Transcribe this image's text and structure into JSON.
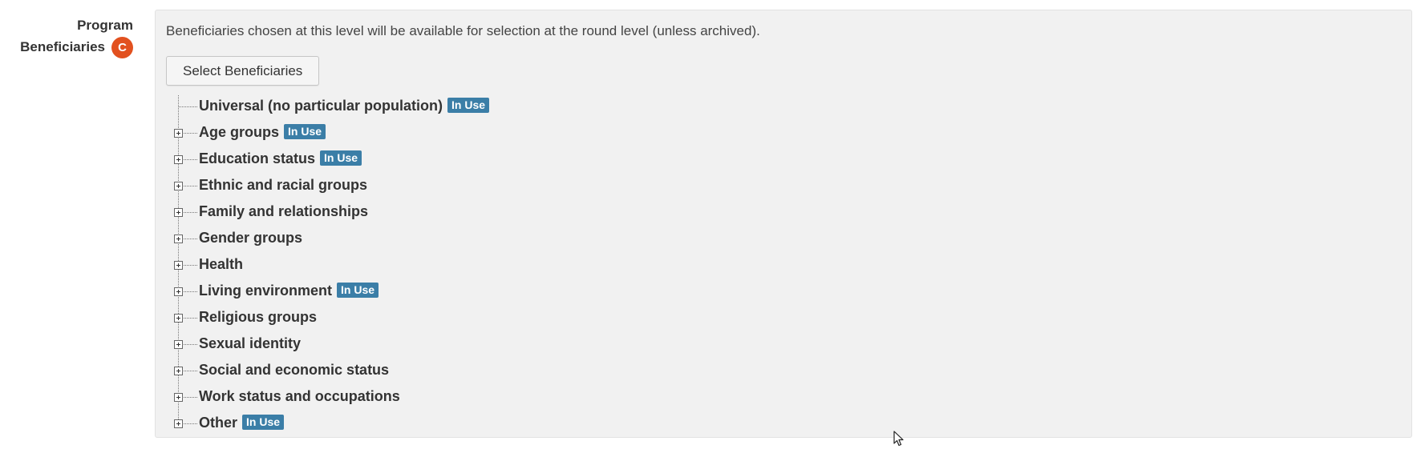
{
  "field": {
    "label_line1": "Program",
    "label_line2": "Beneficiaries",
    "badge": "C",
    "help_text": "Beneficiaries chosen at this level will be available for selection at the round level (unless archived).",
    "select_button": "Select Beneficiaries"
  },
  "tree": {
    "items": [
      {
        "label": "Universal (no particular population)",
        "in_use": "In Use",
        "expandable": false
      },
      {
        "label": "Age groups",
        "in_use": "In Use",
        "expandable": true
      },
      {
        "label": "Education status",
        "in_use": "In Use",
        "expandable": true
      },
      {
        "label": "Ethnic and racial groups",
        "in_use": "",
        "expandable": true
      },
      {
        "label": "Family and relationships",
        "in_use": "",
        "expandable": true
      },
      {
        "label": "Gender groups",
        "in_use": "",
        "expandable": true
      },
      {
        "label": "Health",
        "in_use": "",
        "expandable": true
      },
      {
        "label": "Living environment",
        "in_use": "In Use",
        "expandable": true
      },
      {
        "label": "Religious groups",
        "in_use": "",
        "expandable": true
      },
      {
        "label": "Sexual identity",
        "in_use": "",
        "expandable": true
      },
      {
        "label": "Social and economic status",
        "in_use": "",
        "expandable": true
      },
      {
        "label": "Work status and occupations",
        "in_use": "",
        "expandable": true
      },
      {
        "label": "Other",
        "in_use": "In Use",
        "expandable": true
      }
    ]
  },
  "colors": {
    "badge_c": "#e2511f",
    "in_use_badge": "#3b7ea7",
    "panel_bg": "#f1f1f1"
  },
  "icons": {
    "expander": "plus-square-icon",
    "cursor": "mouse-pointer-icon"
  }
}
